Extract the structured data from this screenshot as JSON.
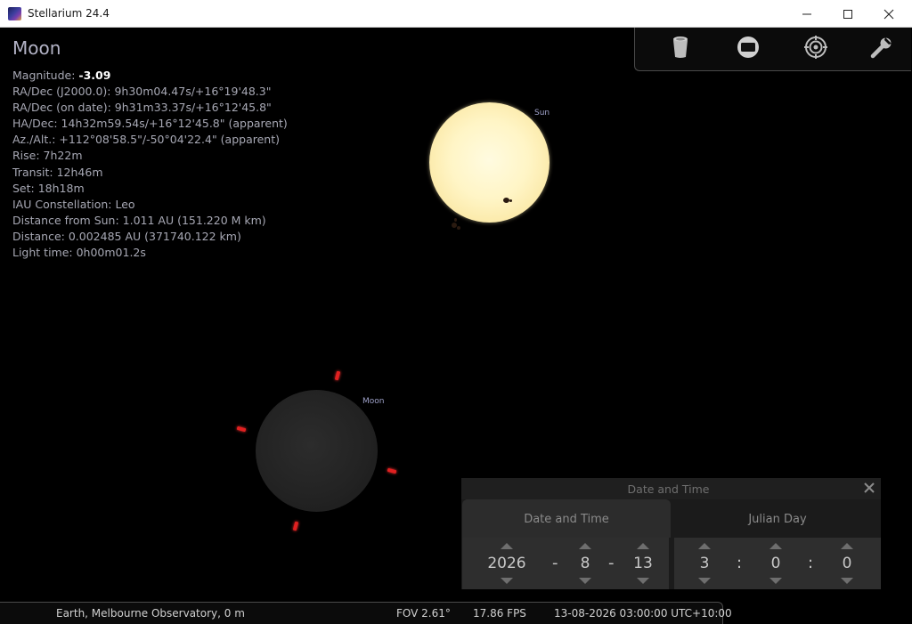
{
  "window": {
    "title": "Stellarium 24.4"
  },
  "info": {
    "object_name": "Moon",
    "magnitude_label": "Magnitude: ",
    "magnitude_value": "-3.09",
    "rows": [
      "RA/Dec (J2000.0): 9h30m04.47s/+16°19'48.3\"",
      "RA/Dec (on date): 9h31m33.37s/+16°12'45.8\"",
      "HA/Dec: 14h32m59.54s/+16°12'45.8\" (apparent)",
      "Az./Alt.: +112°08'58.5\"/-50°04'22.4\" (apparent)",
      "Rise: 7h22m",
      "Transit: 12h46m",
      "Set: 18h18m",
      "IAU Constellation: Leo",
      "Distance from Sun: 1.011 AU (151.220 M km)",
      "Distance: 0.002485 AU (371740.122 km)",
      "Light time: 0h00m01.2s"
    ]
  },
  "toolbar": {
    "icons": [
      "trash-can-icon",
      "screen-icon",
      "target-icon",
      "wrench-icon"
    ]
  },
  "sky_labels": {
    "sun": "Sun",
    "moon": "Moon"
  },
  "date_dialog": {
    "title": "Date and Time",
    "tabs": {
      "date_time": "Date and Time",
      "julian_day": "Julian Day"
    },
    "date": {
      "year": "2026",
      "month": "8",
      "day": "13",
      "sep": "-"
    },
    "time": {
      "hour": "3",
      "minute": "0",
      "second": "0",
      "sep": ":"
    }
  },
  "status": {
    "location": "Earth, Melbourne Observatory, 0 m",
    "fov": "FOV 2.61°",
    "fps": "17.86 FPS",
    "datetime": "13-08-2026 03:00:00 UTC+10:00"
  },
  "colors": {
    "info_text": "#a7a8b4",
    "sky_label": "#9ea1c9",
    "marker": "#e02020",
    "sun": "#fff5c6"
  }
}
